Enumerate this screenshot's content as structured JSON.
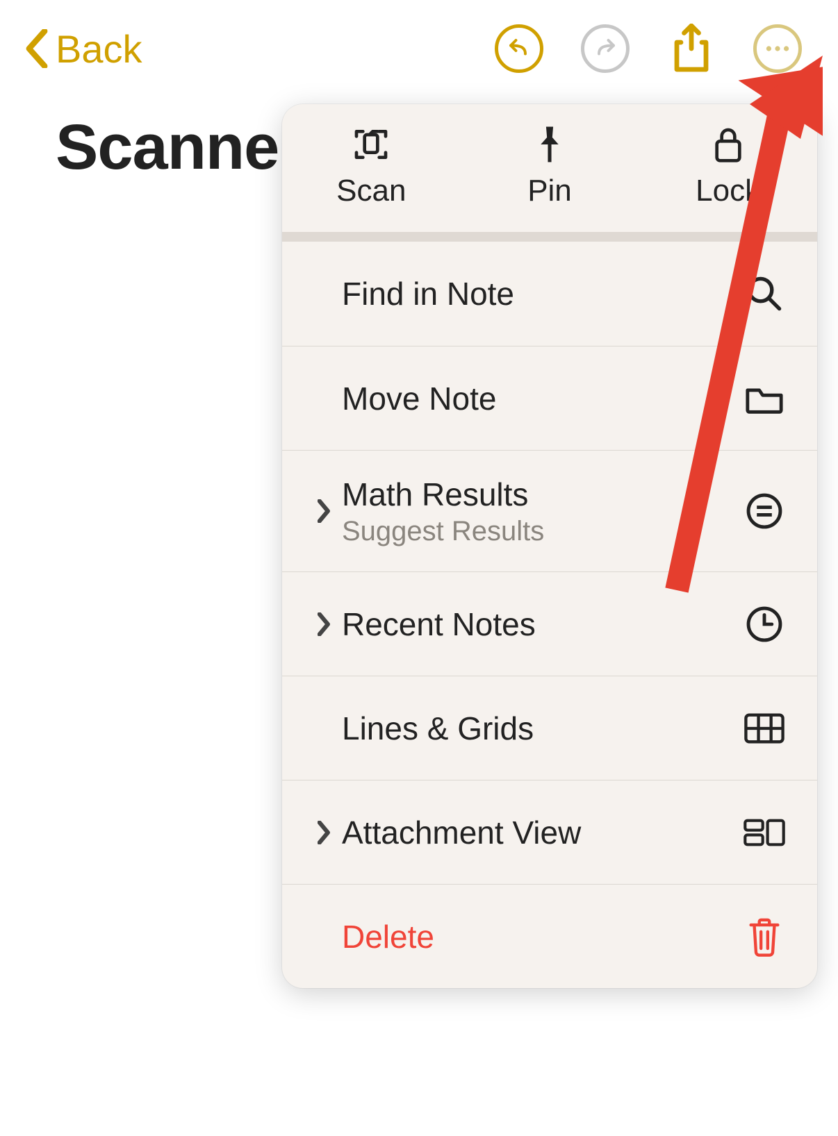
{
  "toolbar": {
    "back_label": "Back"
  },
  "note": {
    "title": "Scanne"
  },
  "menu": {
    "top": {
      "scan": "Scan",
      "pin": "Pin",
      "lock": "Lock"
    },
    "rows": {
      "find": "Find in Note",
      "move": "Move Note",
      "math": {
        "title": "Math Results",
        "subtitle": "Suggest Results"
      },
      "recent": "Recent Notes",
      "lines": "Lines & Grids",
      "attachment": "Attachment View",
      "delete": "Delete"
    }
  }
}
